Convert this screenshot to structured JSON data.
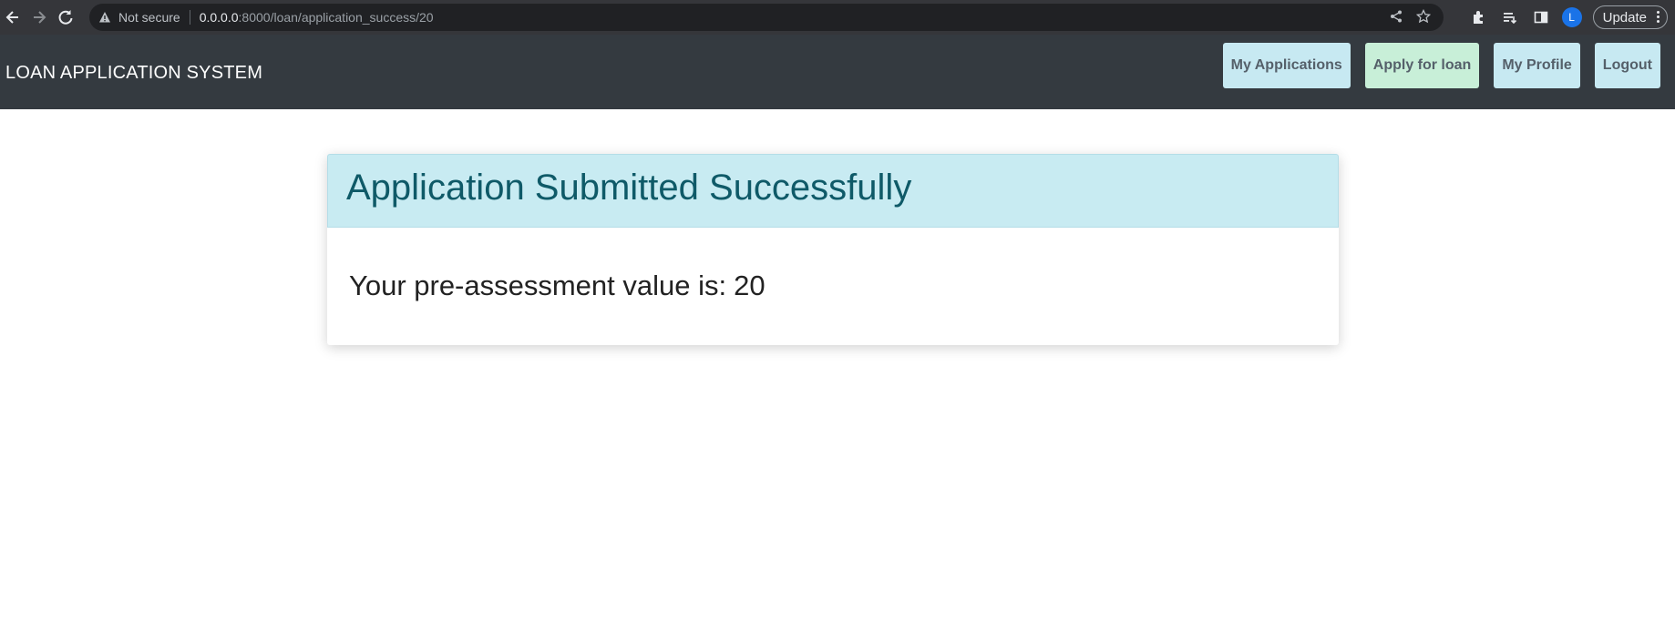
{
  "browser": {
    "security_label": "Not secure",
    "url_host": "0.0.0.0",
    "url_path": ":8000/loan/application_success/20",
    "avatar_letter": "L",
    "update_label": "Update"
  },
  "navbar": {
    "brand": "LOAN APPLICATION SYSTEM",
    "buttons": {
      "my_applications": "My Applications",
      "apply_for_loan": "Apply for loan",
      "my_profile": "My Profile",
      "logout": "Logout"
    }
  },
  "card": {
    "title": "Application Submitted Successfully",
    "assessment_label": "Your pre-assessment value is:",
    "assessment_value": "20"
  },
  "colors": {
    "navbar_bg": "#343a40",
    "info_button": "#c7e9f2",
    "success_button": "#c8efd8",
    "card_header_bg": "#c8ebf2",
    "card_title": "#0f5a68"
  }
}
